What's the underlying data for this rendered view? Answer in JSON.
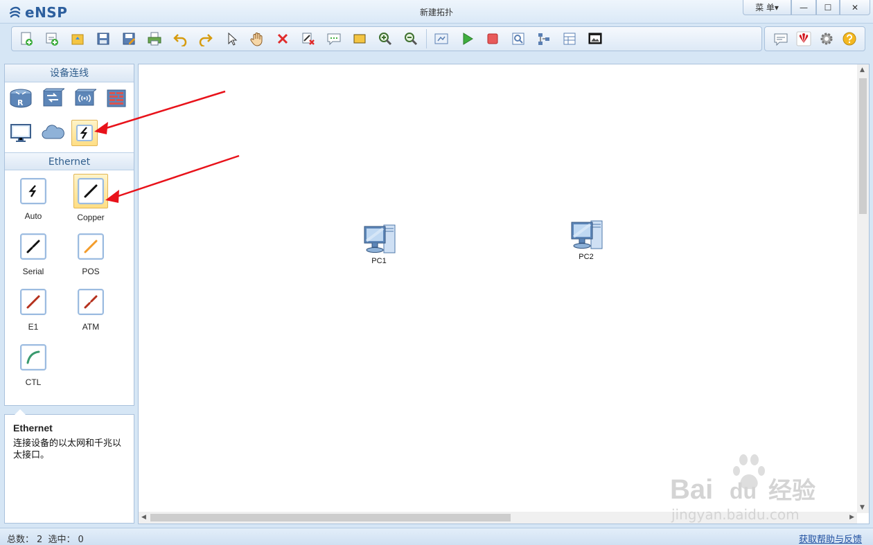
{
  "app": {
    "name": "eNSP",
    "window_title": "新建拓扑",
    "menu_label": "菜 单▾",
    "min_label": "—",
    "max_label": "☐",
    "close_label": "✕"
  },
  "toolbar": {
    "buttons": [
      "new-topology-icon",
      "new-lab-icon",
      "open-icon",
      "save-icon",
      "save-as-icon",
      "print-icon",
      "undo-icon",
      "redo-icon",
      "select-pointer-icon",
      "pan-hand-icon",
      "delete-icon",
      "delete-link-icon",
      "text-note-icon",
      "rectangle-icon",
      "zoom-in-icon",
      "zoom-out-icon",
      "fit-view-icon",
      "start-device-icon",
      "stop-device-icon",
      "capture-icon",
      "topology-icon",
      "table-icon",
      "screenshot-icon"
    ],
    "right_buttons": [
      "message-icon",
      "huawei-logo-icon",
      "settings-gear-icon",
      "help-icon"
    ]
  },
  "panel": {
    "devices_header": "设备连线",
    "devices": [
      "router-icon",
      "switch-icon",
      "wireless-icon",
      "firewall-icon",
      "pc-terminal-icon",
      "cloud-icon",
      "connection-icon"
    ],
    "selected_device": "connection-icon",
    "links_header": "Ethernet",
    "links": [
      {
        "label": "Auto",
        "icon": "auto-link-icon"
      },
      {
        "label": "Copper",
        "icon": "copper-link-icon"
      },
      {
        "label": "Serial",
        "icon": "serial-link-icon"
      },
      {
        "label": "POS",
        "icon": "pos-link-icon"
      },
      {
        "label": "E1",
        "icon": "e1-link-icon"
      },
      {
        "label": "ATM",
        "icon": "atm-link-icon"
      },
      {
        "label": "CTL",
        "icon": "ctl-link-icon"
      }
    ],
    "selected_link": "Copper"
  },
  "info": {
    "title": "Ethernet",
    "description": "连接设备的以太网和千兆以太接口。"
  },
  "canvas": {
    "nodes": [
      {
        "label": "PC1",
        "icon": "pc-icon"
      },
      {
        "label": "PC2",
        "icon": "pc-icon"
      }
    ]
  },
  "status": {
    "total_label": "总数：",
    "total_value": "2",
    "selected_label": "选中：",
    "selected_value": "0",
    "help_link": "获取帮助与反馈"
  },
  "watermark": {
    "brand": "Bai",
    "brand2": "du",
    "product": "经验",
    "url": "jingyan.baidu.com"
  },
  "colors": {
    "accent": "#2d5f9e",
    "panel_bg": "#d6e6f5",
    "selected_bg": "#ffde84",
    "annotation_red": "#e8121a"
  }
}
